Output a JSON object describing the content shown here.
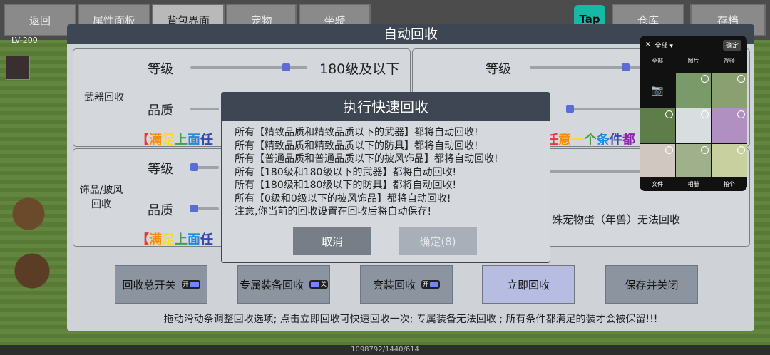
{
  "top_nav": {
    "tabs": [
      "返回",
      "属性面板",
      "背包界面",
      "宠物",
      "坐骑"
    ],
    "active_tab": "背包界面",
    "right_buttons": [
      "仓库",
      "存档"
    ],
    "tap_logo": "Tap"
  },
  "player": {
    "level": "LV-200"
  },
  "dialog": {
    "title": "自动回收",
    "weapon_panel": {
      "label": "武器回收",
      "level_label": "等级",
      "level_value": "180级及以下",
      "level_fraction": 0.82,
      "quality_label": "品质",
      "rainbow_text": "【满足上面任"
    },
    "armor_panel": {
      "level_label": "等级",
      "level_fraction": 0.82,
      "rainbow_text": "任意一个条件都"
    },
    "accessory_panel": {
      "label": "饰品/披风\n回收",
      "level_label": "等级",
      "quality_label": "品质",
      "rainbow_text": "【满足上面任"
    },
    "pet_panel": {
      "note": "殊宠物蛋（年兽）无法回收"
    },
    "actions": [
      {
        "label": "回收总开关",
        "toggle": "开"
      },
      {
        "label": "专属装备回收",
        "toggle": "关"
      },
      {
        "label": "套装回收",
        "toggle": "开"
      },
      {
        "label": "立即回收"
      },
      {
        "label": "保存并关闭"
      }
    ],
    "footer_hint": "拖动滑动条调整回收选项; 点击立即回收可快速回收一次; 专属装备无法回收 ; 所有条件都满足的装才会被保留!!!"
  },
  "confirm": {
    "title": "执行快速回收",
    "lines": [
      "所有【精致品质和精致品质以下的武器】都将自动回收!",
      "所有【精致品质和精致品质以下的防具】都将自动回收!",
      "所有【普通品质和普通品质以下的披风饰品】都将自动回收!",
      "所有【180级和180级以下的武器】都将自动回收!",
      "所有【180级和180级以下的防具】都将自动回收!",
      "所有【0级和0级以下的披风饰品】都将自动回收!",
      "注意,你当前的回收设置在回收后将自动保存!"
    ],
    "cancel_label": "取消",
    "ok_label": "确定(8)"
  },
  "phone": {
    "top_title": "全部 ▾",
    "top_action": "确定",
    "tabs": [
      "全部",
      "图片",
      "视频"
    ],
    "bottom": [
      "文件",
      "相册",
      "拍个"
    ]
  },
  "bottom_strip": "1098792/1440/614",
  "colors": {
    "header_bg": "#3e4654",
    "rainbow": [
      "#e53935",
      "#fb8c00",
      "#fdd835",
      "#43a047",
      "#1e88e5",
      "#3949ab",
      "#8e24aa"
    ]
  }
}
